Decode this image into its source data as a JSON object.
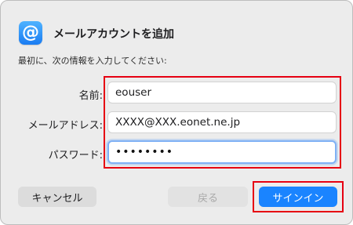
{
  "dialog": {
    "title": "メールアカウントを追加",
    "app_icon_glyph": "@",
    "app_icon_name": "mail-at-icon",
    "instruction": "最初に、次の情報を入力してください:"
  },
  "form": {
    "name_label": "名前:",
    "name_value": "eouser",
    "email_label": "メールアドレス:",
    "email_value": "XXXX@XXX.eonet.ne.jp",
    "password_label": "パスワード:",
    "password_value": "••••••••"
  },
  "buttons": {
    "cancel": "キャンセル",
    "back": "戻る",
    "sign_in": "サインイン"
  },
  "colors": {
    "accent": "#1a84ff",
    "highlight": "#e60012",
    "focus_ring": "#7fb1f5"
  }
}
